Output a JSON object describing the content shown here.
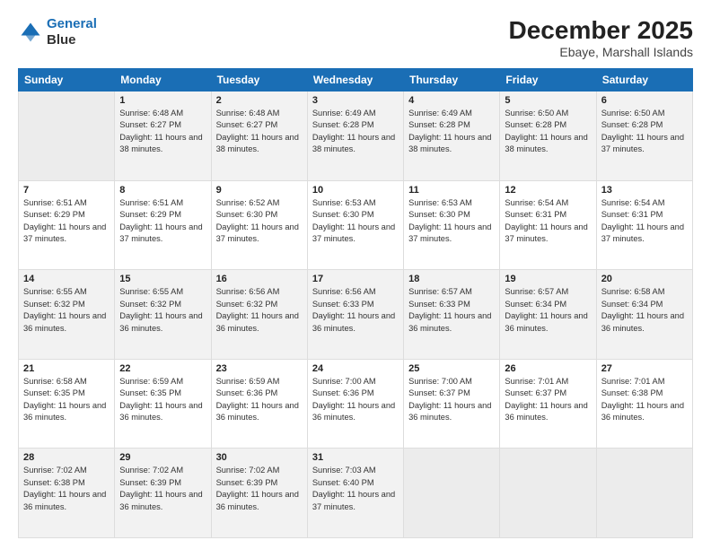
{
  "header": {
    "logo_line1": "General",
    "logo_line2": "Blue",
    "month": "December 2025",
    "location": "Ebaye, Marshall Islands"
  },
  "weekdays": [
    "Sunday",
    "Monday",
    "Tuesday",
    "Wednesday",
    "Thursday",
    "Friday",
    "Saturday"
  ],
  "weeks": [
    [
      {
        "day": "",
        "sunrise": "",
        "sunset": "",
        "daylight": ""
      },
      {
        "day": "1",
        "sunrise": "Sunrise: 6:48 AM",
        "sunset": "Sunset: 6:27 PM",
        "daylight": "Daylight: 11 hours and 38 minutes."
      },
      {
        "day": "2",
        "sunrise": "Sunrise: 6:48 AM",
        "sunset": "Sunset: 6:27 PM",
        "daylight": "Daylight: 11 hours and 38 minutes."
      },
      {
        "day": "3",
        "sunrise": "Sunrise: 6:49 AM",
        "sunset": "Sunset: 6:28 PM",
        "daylight": "Daylight: 11 hours and 38 minutes."
      },
      {
        "day": "4",
        "sunrise": "Sunrise: 6:49 AM",
        "sunset": "Sunset: 6:28 PM",
        "daylight": "Daylight: 11 hours and 38 minutes."
      },
      {
        "day": "5",
        "sunrise": "Sunrise: 6:50 AM",
        "sunset": "Sunset: 6:28 PM",
        "daylight": "Daylight: 11 hours and 38 minutes."
      },
      {
        "day": "6",
        "sunrise": "Sunrise: 6:50 AM",
        "sunset": "Sunset: 6:28 PM",
        "daylight": "Daylight: 11 hours and 37 minutes."
      }
    ],
    [
      {
        "day": "7",
        "sunrise": "Sunrise: 6:51 AM",
        "sunset": "Sunset: 6:29 PM",
        "daylight": "Daylight: 11 hours and 37 minutes."
      },
      {
        "day": "8",
        "sunrise": "Sunrise: 6:51 AM",
        "sunset": "Sunset: 6:29 PM",
        "daylight": "Daylight: 11 hours and 37 minutes."
      },
      {
        "day": "9",
        "sunrise": "Sunrise: 6:52 AM",
        "sunset": "Sunset: 6:30 PM",
        "daylight": "Daylight: 11 hours and 37 minutes."
      },
      {
        "day": "10",
        "sunrise": "Sunrise: 6:53 AM",
        "sunset": "Sunset: 6:30 PM",
        "daylight": "Daylight: 11 hours and 37 minutes."
      },
      {
        "day": "11",
        "sunrise": "Sunrise: 6:53 AM",
        "sunset": "Sunset: 6:30 PM",
        "daylight": "Daylight: 11 hours and 37 minutes."
      },
      {
        "day": "12",
        "sunrise": "Sunrise: 6:54 AM",
        "sunset": "Sunset: 6:31 PM",
        "daylight": "Daylight: 11 hours and 37 minutes."
      },
      {
        "day": "13",
        "sunrise": "Sunrise: 6:54 AM",
        "sunset": "Sunset: 6:31 PM",
        "daylight": "Daylight: 11 hours and 37 minutes."
      }
    ],
    [
      {
        "day": "14",
        "sunrise": "Sunrise: 6:55 AM",
        "sunset": "Sunset: 6:32 PM",
        "daylight": "Daylight: 11 hours and 36 minutes."
      },
      {
        "day": "15",
        "sunrise": "Sunrise: 6:55 AM",
        "sunset": "Sunset: 6:32 PM",
        "daylight": "Daylight: 11 hours and 36 minutes."
      },
      {
        "day": "16",
        "sunrise": "Sunrise: 6:56 AM",
        "sunset": "Sunset: 6:32 PM",
        "daylight": "Daylight: 11 hours and 36 minutes."
      },
      {
        "day": "17",
        "sunrise": "Sunrise: 6:56 AM",
        "sunset": "Sunset: 6:33 PM",
        "daylight": "Daylight: 11 hours and 36 minutes."
      },
      {
        "day": "18",
        "sunrise": "Sunrise: 6:57 AM",
        "sunset": "Sunset: 6:33 PM",
        "daylight": "Daylight: 11 hours and 36 minutes."
      },
      {
        "day": "19",
        "sunrise": "Sunrise: 6:57 AM",
        "sunset": "Sunset: 6:34 PM",
        "daylight": "Daylight: 11 hours and 36 minutes."
      },
      {
        "day": "20",
        "sunrise": "Sunrise: 6:58 AM",
        "sunset": "Sunset: 6:34 PM",
        "daylight": "Daylight: 11 hours and 36 minutes."
      }
    ],
    [
      {
        "day": "21",
        "sunrise": "Sunrise: 6:58 AM",
        "sunset": "Sunset: 6:35 PM",
        "daylight": "Daylight: 11 hours and 36 minutes."
      },
      {
        "day": "22",
        "sunrise": "Sunrise: 6:59 AM",
        "sunset": "Sunset: 6:35 PM",
        "daylight": "Daylight: 11 hours and 36 minutes."
      },
      {
        "day": "23",
        "sunrise": "Sunrise: 6:59 AM",
        "sunset": "Sunset: 6:36 PM",
        "daylight": "Daylight: 11 hours and 36 minutes."
      },
      {
        "day": "24",
        "sunrise": "Sunrise: 7:00 AM",
        "sunset": "Sunset: 6:36 PM",
        "daylight": "Daylight: 11 hours and 36 minutes."
      },
      {
        "day": "25",
        "sunrise": "Sunrise: 7:00 AM",
        "sunset": "Sunset: 6:37 PM",
        "daylight": "Daylight: 11 hours and 36 minutes."
      },
      {
        "day": "26",
        "sunrise": "Sunrise: 7:01 AM",
        "sunset": "Sunset: 6:37 PM",
        "daylight": "Daylight: 11 hours and 36 minutes."
      },
      {
        "day": "27",
        "sunrise": "Sunrise: 7:01 AM",
        "sunset": "Sunset: 6:38 PM",
        "daylight": "Daylight: 11 hours and 36 minutes."
      }
    ],
    [
      {
        "day": "28",
        "sunrise": "Sunrise: 7:02 AM",
        "sunset": "Sunset: 6:38 PM",
        "daylight": "Daylight: 11 hours and 36 minutes."
      },
      {
        "day": "29",
        "sunrise": "Sunrise: 7:02 AM",
        "sunset": "Sunset: 6:39 PM",
        "daylight": "Daylight: 11 hours and 36 minutes."
      },
      {
        "day": "30",
        "sunrise": "Sunrise: 7:02 AM",
        "sunset": "Sunset: 6:39 PM",
        "daylight": "Daylight: 11 hours and 36 minutes."
      },
      {
        "day": "31",
        "sunrise": "Sunrise: 7:03 AM",
        "sunset": "Sunset: 6:40 PM",
        "daylight": "Daylight: 11 hours and 37 minutes."
      },
      {
        "day": "",
        "sunrise": "",
        "sunset": "",
        "daylight": ""
      },
      {
        "day": "",
        "sunrise": "",
        "sunset": "",
        "daylight": ""
      },
      {
        "day": "",
        "sunrise": "",
        "sunset": "",
        "daylight": ""
      }
    ]
  ]
}
